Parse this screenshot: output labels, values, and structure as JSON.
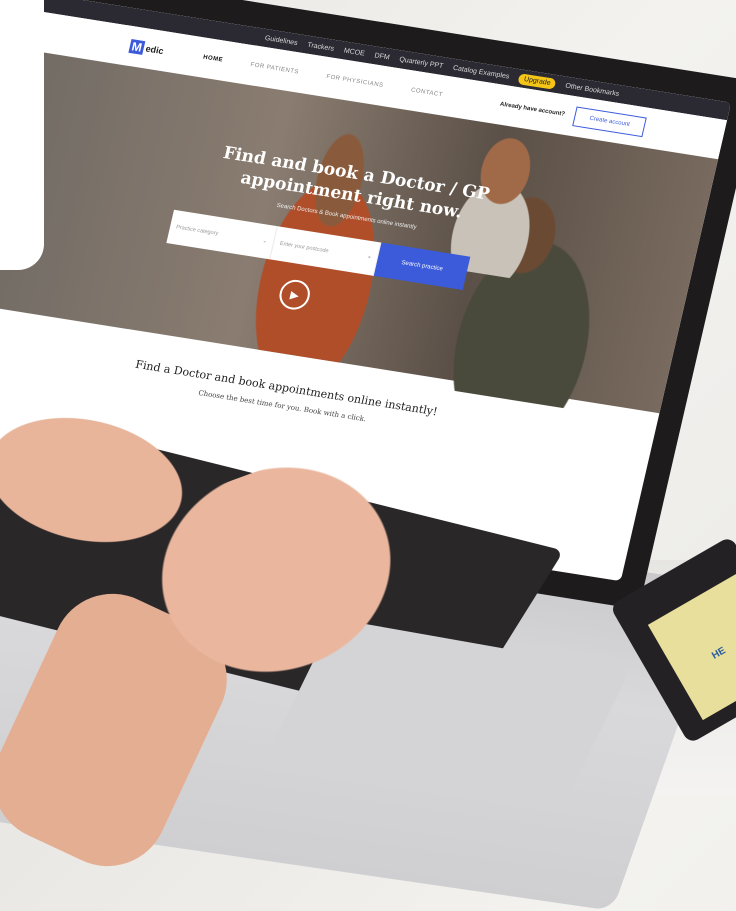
{
  "browser": {
    "bookmarks": [
      "Guidelines",
      "Trackers",
      "MCOE",
      "DFM",
      "Quarterly PPT",
      "Catalog Examples",
      "Other Bookmarks"
    ],
    "upgrade_label": "Upgrade"
  },
  "nav": {
    "logo_mark": "M",
    "logo_text": "edic",
    "links": [
      "HOME",
      "FOR PATIENTS",
      "FOR PHYSICIANS",
      "CONTACT"
    ],
    "account_question": "Already have account?",
    "create_account": "Create account"
  },
  "hero": {
    "title": "Find and book a Doctor / GP appointment right now.",
    "subtitle": "Search Doctors & Book appointments online instantly",
    "practice_placeholder": "Practice category",
    "postcode_placeholder": "Enter your postcode",
    "search_button": "Search practice"
  },
  "section": {
    "title": "Find a Doctor and book appointments online instantly!",
    "subtitle": "Choose the best time for you. Book with a click."
  },
  "notepad": {
    "text": "HE"
  },
  "colors": {
    "accent": "#3b5bdb",
    "upgrade": "#f5c518"
  }
}
